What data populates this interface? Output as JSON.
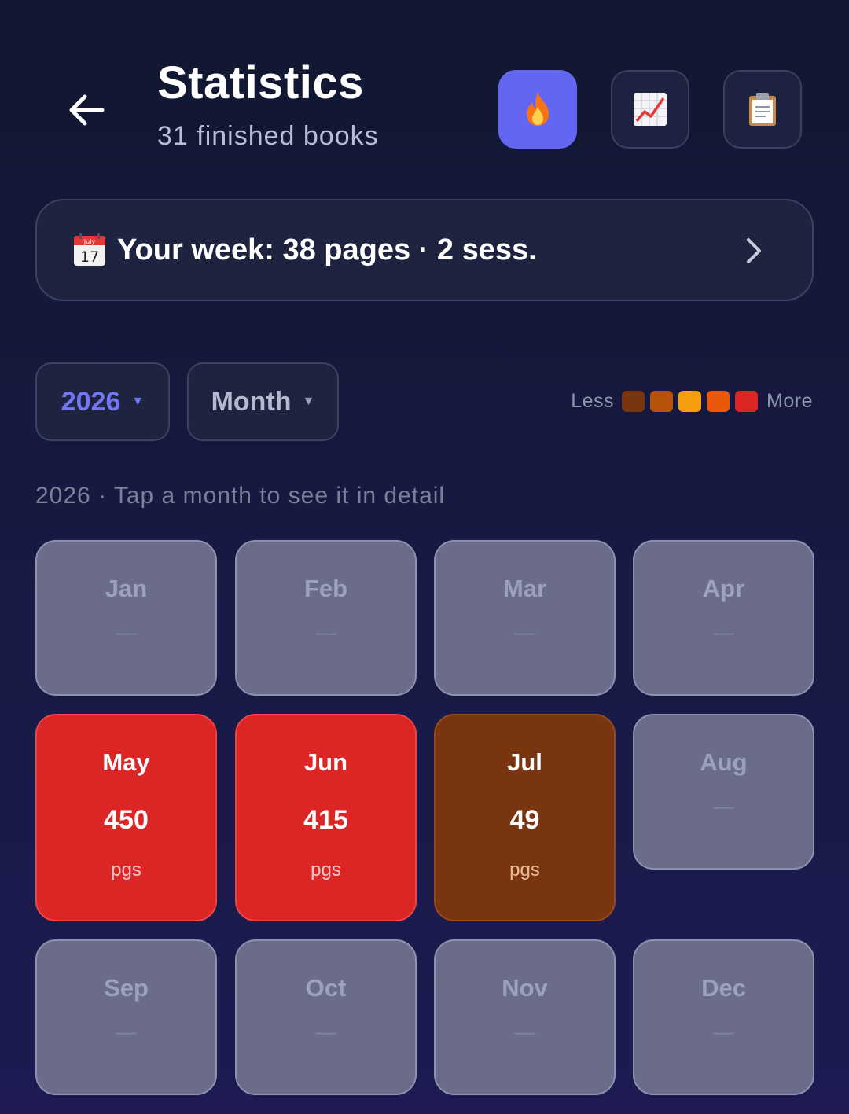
{
  "header": {
    "title": "Statistics",
    "subtitle": "31 finished books",
    "buttons": [
      {
        "name": "streak",
        "icon": "fire-icon",
        "active": true
      },
      {
        "name": "trend",
        "icon": "chart-increasing-icon",
        "active": false
      },
      {
        "name": "list",
        "icon": "clipboard-icon",
        "active": false
      }
    ],
    "accent_color": "#6366f1"
  },
  "week": {
    "icon": "calendar-icon",
    "calendar_month": "July",
    "calendar_day": "17",
    "text": "Your week: 38 pages · 2 sess."
  },
  "filters": {
    "year": "2026",
    "period": "Month"
  },
  "legend": {
    "less": "Less",
    "more": "More",
    "colors": [
      "#78350f",
      "#b45309",
      "#f59e0b",
      "#ea580c",
      "#dc2626"
    ]
  },
  "hint": "2026 · Tap a month to see it in detail",
  "months": [
    {
      "name": "Jan",
      "empty_label": "—"
    },
    {
      "name": "Feb",
      "empty_label": "—"
    },
    {
      "name": "Mar",
      "empty_label": "—"
    },
    {
      "name": "Apr",
      "empty_label": "—"
    },
    {
      "name": "May",
      "value": "450",
      "unit": "pgs",
      "level": 5
    },
    {
      "name": "Jun",
      "value": "415",
      "unit": "pgs",
      "level": 5
    },
    {
      "name": "Jul",
      "value": "49",
      "unit": "pgs",
      "level": 1
    },
    {
      "name": "Aug",
      "empty_label": "—"
    },
    {
      "name": "Sep",
      "empty_label": "—"
    },
    {
      "name": "Oct",
      "empty_label": "—"
    },
    {
      "name": "Nov",
      "empty_label": "—"
    },
    {
      "name": "Dec",
      "empty_label": "—"
    }
  ]
}
